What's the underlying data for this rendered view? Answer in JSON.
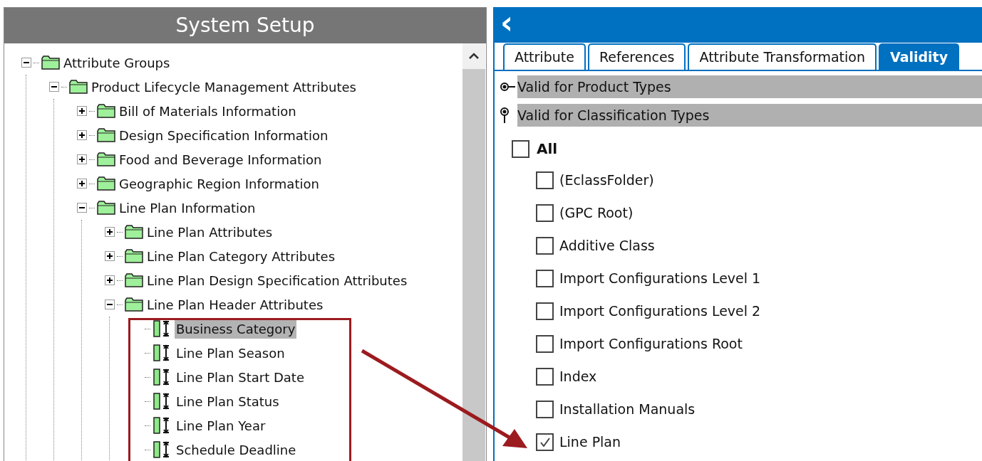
{
  "left_panel": {
    "title": "System Setup",
    "tree": [
      {
        "label": "Attribute Groups",
        "kind": "folder",
        "expanded": true,
        "selected": false,
        "children": [
          {
            "label": "Product Lifecycle Management Attributes",
            "kind": "folder",
            "expanded": true,
            "selected": false,
            "children": [
              {
                "label": "Bill of Materials Information",
                "kind": "folder",
                "expanded": false,
                "selected": false
              },
              {
                "label": "Design Specification Information",
                "kind": "folder",
                "expanded": false,
                "selected": false
              },
              {
                "label": "Food and Beverage Information",
                "kind": "folder",
                "expanded": false,
                "selected": false
              },
              {
                "label": "Geographic Region Information",
                "kind": "folder",
                "expanded": false,
                "selected": false
              },
              {
                "label": "Line Plan Information",
                "kind": "folder",
                "expanded": true,
                "selected": false,
                "children": [
                  {
                    "label": "Line Plan Attributes",
                    "kind": "folder",
                    "expanded": false,
                    "selected": false
                  },
                  {
                    "label": "Line Plan Category Attributes",
                    "kind": "folder",
                    "expanded": false,
                    "selected": false
                  },
                  {
                    "label": "Line Plan Design Specification Attributes",
                    "kind": "folder",
                    "expanded": false,
                    "selected": false
                  },
                  {
                    "label": "Line Plan Header Attributes",
                    "kind": "folder",
                    "expanded": true,
                    "selected": false,
                    "children": [
                      {
                        "label": "Business Category",
                        "kind": "attribute",
                        "selected": true
                      },
                      {
                        "label": "Line Plan Season",
                        "kind": "attribute",
                        "selected": false
                      },
                      {
                        "label": "Line Plan Start Date",
                        "kind": "attribute",
                        "selected": false
                      },
                      {
                        "label": "Line Plan Status",
                        "kind": "attribute",
                        "selected": false
                      },
                      {
                        "label": "Line Plan Year",
                        "kind": "attribute",
                        "selected": false
                      },
                      {
                        "label": "Schedule Deadline",
                        "kind": "attribute",
                        "selected": false
                      }
                    ]
                  }
                ]
              }
            ]
          }
        ]
      }
    ]
  },
  "right_panel": {
    "back": "‹",
    "tabs": [
      {
        "label": "Attribute",
        "selected": false
      },
      {
        "label": "References",
        "selected": false
      },
      {
        "label": "Attribute Transformation",
        "selected": false
      },
      {
        "label": "Validity",
        "selected": true
      }
    ],
    "sections": [
      {
        "label": "Valid for Product Types",
        "kind": "product"
      },
      {
        "label": "Valid for Classification Types",
        "kind": "classification"
      }
    ],
    "all": {
      "label": "All",
      "checked": false
    },
    "types": [
      {
        "label": "(EclassFolder)",
        "checked": false
      },
      {
        "label": "(GPC Root)",
        "checked": false
      },
      {
        "label": "Additive Class",
        "checked": false
      },
      {
        "label": "Import Configurations Level 1",
        "checked": false
      },
      {
        "label": "Import Configurations Level 2",
        "checked": false
      },
      {
        "label": "Import Configurations Root",
        "checked": false
      },
      {
        "label": "Index",
        "checked": false
      },
      {
        "label": "Installation Manuals",
        "checked": false
      },
      {
        "label": "Line Plan",
        "checked": true
      }
    ]
  }
}
